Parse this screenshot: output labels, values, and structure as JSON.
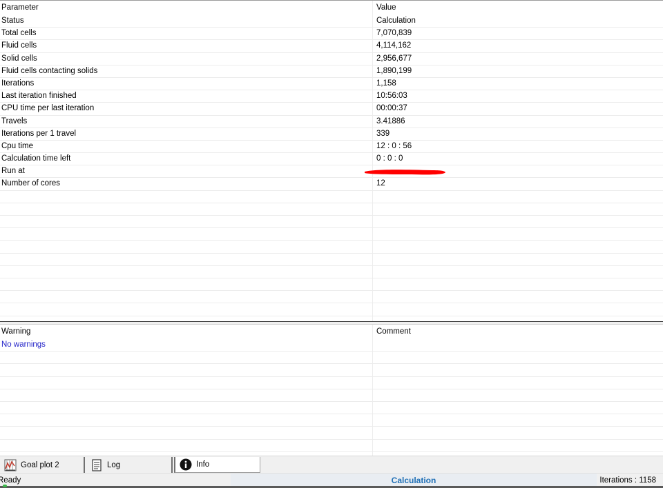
{
  "info_table": {
    "headers": {
      "parameter": "Parameter",
      "value": "Value"
    },
    "rows": [
      {
        "parameter": "Status",
        "value": "Calculation"
      },
      {
        "parameter": "Total cells",
        "value": "7,070,839"
      },
      {
        "parameter": "Fluid cells",
        "value": "4,114,162"
      },
      {
        "parameter": "Solid cells",
        "value": "2,956,677"
      },
      {
        "parameter": "Fluid cells contacting solids",
        "value": "1,890,199"
      },
      {
        "parameter": "Iterations",
        "value": "1,158"
      },
      {
        "parameter": "Last iteration finished",
        "value": "10:56:03"
      },
      {
        "parameter": "CPU time per last iteration",
        "value": "00:00:37"
      },
      {
        "parameter": "Travels",
        "value": "3.41886"
      },
      {
        "parameter": "Iterations per 1 travel",
        "value": "339"
      },
      {
        "parameter": "Cpu time",
        "value": "12 : 0 : 56"
      },
      {
        "parameter": "Calculation time left",
        "value": "0 : 0 : 0"
      },
      {
        "parameter": "Run at",
        "value": ""
      },
      {
        "parameter": "Number of cores",
        "value": "12"
      }
    ],
    "redaction_color": "#ff0000"
  },
  "warnings_table": {
    "headers": {
      "warning": "Warning",
      "comment": "Comment"
    },
    "rows": [
      {
        "warning": "No warnings",
        "comment": ""
      }
    ],
    "warning_color": "#2323c8"
  },
  "tabs": [
    {
      "label": "Goal plot 2",
      "icon": "goal-plot-icon",
      "active": false
    },
    {
      "label": "Log",
      "icon": "log-document-icon",
      "active": false
    },
    {
      "label": "Info",
      "icon": "info-icon",
      "active": true
    }
  ],
  "status_bar": {
    "left": "Ready",
    "center": "Calculation",
    "right": "Iterations : 1158",
    "center_color": "#1f6fb5"
  }
}
